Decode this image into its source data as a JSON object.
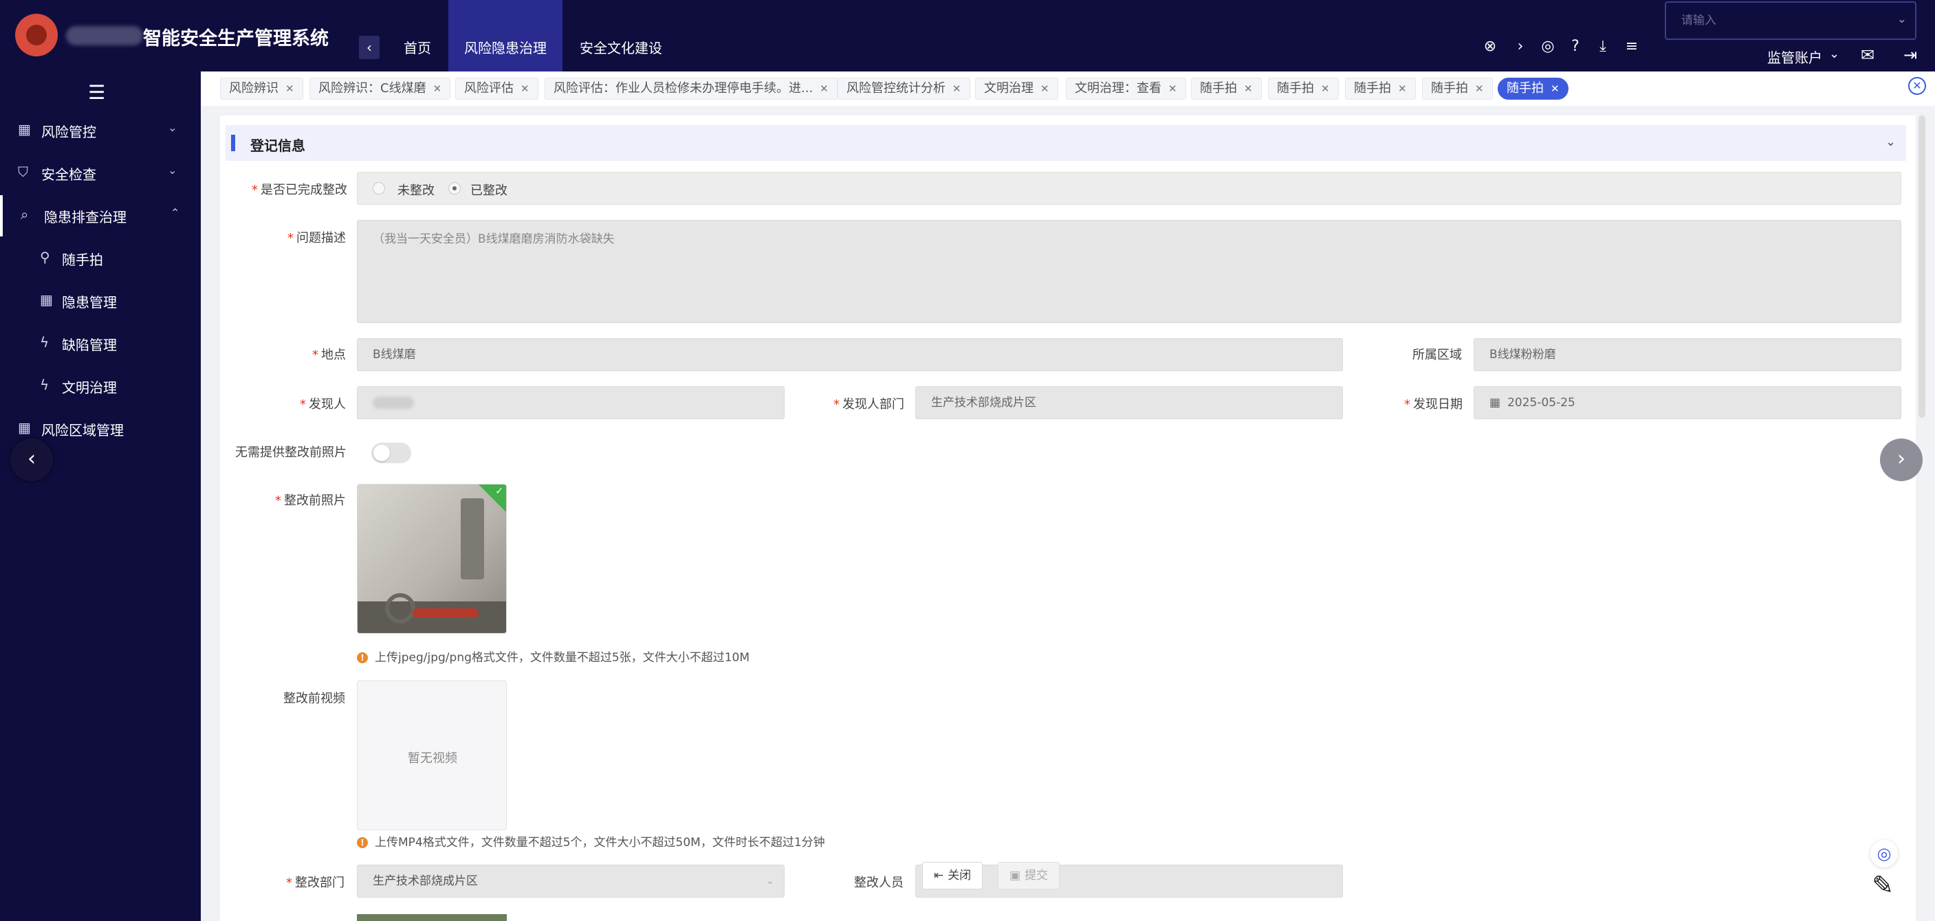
{
  "header": {
    "app_title": "智能安全生产管理系统",
    "nav": [
      {
        "label": "首页"
      },
      {
        "label": "风险隐患治理"
      },
      {
        "label": "安全文化建设"
      }
    ],
    "search_placeholder": "请输入",
    "user_label": "监管账户",
    "tool_icons": [
      "close-circle-icon",
      "chevron-right-icon",
      "headset-icon",
      "help-icon",
      "download-icon",
      "settings-icon"
    ],
    "right_icons": [
      "mail-icon",
      "logout-icon"
    ]
  },
  "sidebar": {
    "items": [
      {
        "label": "风险管控",
        "icon": "dashboard-icon"
      },
      {
        "label": "安全检查",
        "icon": "shield-icon"
      },
      {
        "label": "隐患排查治理",
        "icon": "search-icon"
      },
      {
        "label": "随手拍",
        "icon": "person-icon"
      },
      {
        "label": "隐患管理",
        "icon": "dashboard-icon"
      },
      {
        "label": "缺陷管理",
        "icon": "bolt-icon"
      },
      {
        "label": "文明治理",
        "icon": "bolt-icon"
      },
      {
        "label": "风险区域管理",
        "icon": "dashboard-icon"
      }
    ]
  },
  "tags": [
    "风险辨识",
    "风险辨识：C线煤磨",
    "风险评估",
    "风险评估：作业人员检修未办理停电手续。进...",
    "风险管控统计分析",
    "文明治理",
    "文明治理：查看",
    "随手拍",
    "随手拍",
    "随手拍",
    "随手拍",
    "随手拍"
  ],
  "form": {
    "section_title": "登记信息",
    "rectified": {
      "label": "是否已完成整改",
      "options": [
        "未整改",
        "已整改"
      ],
      "selected": "已整改"
    },
    "description": {
      "label": "问题描述",
      "value": "（我当一天安全员）B线煤磨磨房消防水袋缺失"
    },
    "location": {
      "label": "地点",
      "value": "B线煤磨"
    },
    "area": {
      "label": "所属区域",
      "value": "B线煤粉粉磨"
    },
    "discoverer": {
      "label": "发现人",
      "value": ""
    },
    "discoverer_dept": {
      "label": "发现人部门",
      "value": "生产技术部烧成片区"
    },
    "discover_date": {
      "label": "发现日期",
      "value": "2025-05-25"
    },
    "no_photo_toggle": {
      "label": "无需提供整改前照片"
    },
    "photo_before": {
      "label": "整改前照片",
      "hint": "上传jpeg/jpg/png格式文件，文件数量不超过5张，文件大小不超过10M"
    },
    "video_before": {
      "label": "整改前视频",
      "empty_text": "暂无视频",
      "hint": "上传MP4格式文件，文件数量不超过5个，文件大小不超过50M，文件时长不超过1分钟"
    },
    "rectify_dept": {
      "label": "整改部门",
      "value": "生产技术部烧成片区"
    },
    "rectify_person": {
      "label": "整改人员"
    },
    "buttons": {
      "close": "关闭",
      "submit": "提交"
    }
  },
  "colors": {
    "header_bg": "#0f0d3e",
    "accent": "#3d5bdb",
    "active_nav": "#2a2b8e",
    "required": "#e2341c"
  }
}
